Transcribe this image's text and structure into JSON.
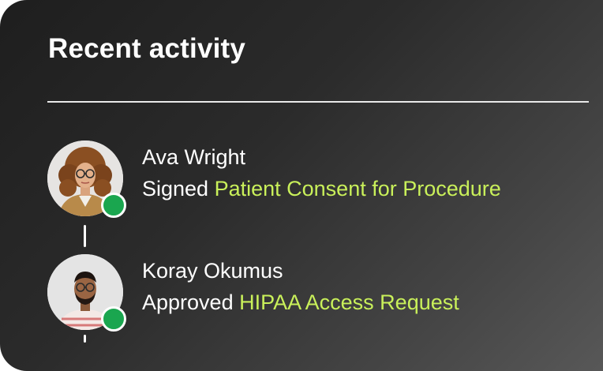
{
  "card": {
    "title": "Recent activity"
  },
  "activities": [
    {
      "name": "Ava Wright",
      "action": "Signed",
      "document": "Patient Consent for Procedure",
      "status": "online"
    },
    {
      "name": "Koray Okumus",
      "action": "Approved",
      "document": "HIPAA Access Request",
      "status": "online"
    }
  ],
  "colors": {
    "link": "#c9f05a",
    "status_online": "#1aa64f"
  }
}
